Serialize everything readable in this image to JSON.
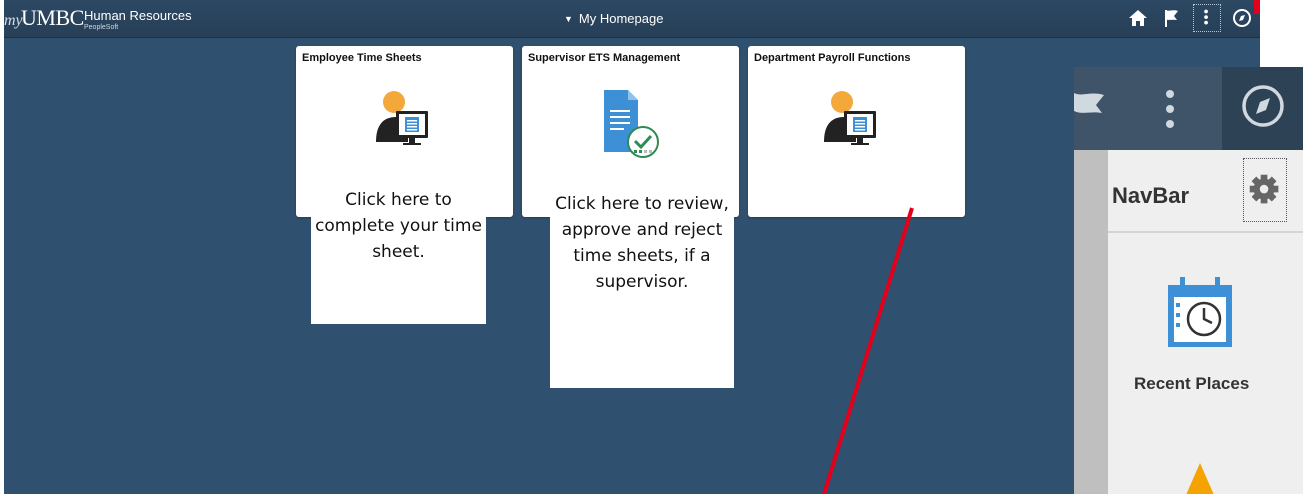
{
  "header": {
    "logo_my": "my",
    "logo_umbc": "UMBC",
    "logo_title": "Human Resources",
    "logo_sub": "PeopleSoft",
    "page_title": "My Homepage",
    "icons": [
      "home-icon",
      "flag-icon",
      "more-vertical-icon",
      "compass-icon"
    ]
  },
  "tiles": [
    {
      "title": "Employee Time Sheets",
      "icon": "employee-timesheet-icon"
    },
    {
      "title": "Supervisor ETS Management",
      "icon": "approval-document-icon"
    },
    {
      "title": "Department Payroll Functions",
      "icon": "payroll-icon"
    }
  ],
  "callouts": [
    "Click here to complete your time sheet.",
    "Click here to review, approve and reject time sheets, if a supervisor."
  ],
  "navbar": {
    "label": "NavBar",
    "recent_places": "Recent Places",
    "colors": {
      "panel": "#efefef",
      "header": "#3f5469",
      "accent": "#f4a300",
      "icon_blue": "#3d8fd6"
    }
  },
  "colors": {
    "background": "#30506f",
    "topbar": "#2a4560",
    "annotation": "#e2001a"
  }
}
